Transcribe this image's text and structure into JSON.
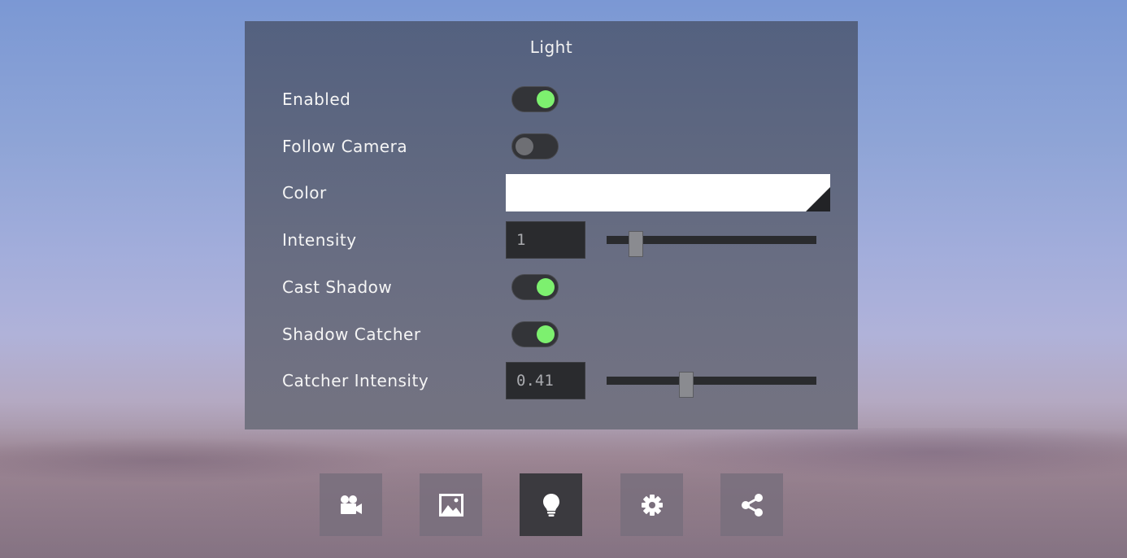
{
  "panel": {
    "title": "Light",
    "rows": {
      "enabled": {
        "label": "Enabled",
        "value": true
      },
      "follow_camera": {
        "label": "Follow Camera",
        "value": false
      },
      "color": {
        "label": "Color",
        "value": "#ffffff"
      },
      "intensity": {
        "label": "Intensity",
        "value": "1",
        "slider_fraction": 0.14
      },
      "cast_shadow": {
        "label": "Cast Shadow",
        "value": true
      },
      "shadow_catcher": {
        "label": "Shadow Catcher",
        "value": true
      },
      "catcher_intensity": {
        "label": "Catcher Intensity",
        "value": "0.41",
        "slider_fraction": 0.38
      }
    }
  },
  "toolbar": {
    "buttons": [
      {
        "icon": "camera-icon",
        "active": false
      },
      {
        "icon": "image-icon",
        "active": false
      },
      {
        "icon": "lightbulb-icon",
        "active": true
      },
      {
        "icon": "gear-icon",
        "active": false
      },
      {
        "icon": "share-icon",
        "active": false
      }
    ]
  },
  "colors": {
    "toggle_on": "#7df06f",
    "toggle_off": "#6e6f74",
    "active_button": "#3b3a3f"
  }
}
